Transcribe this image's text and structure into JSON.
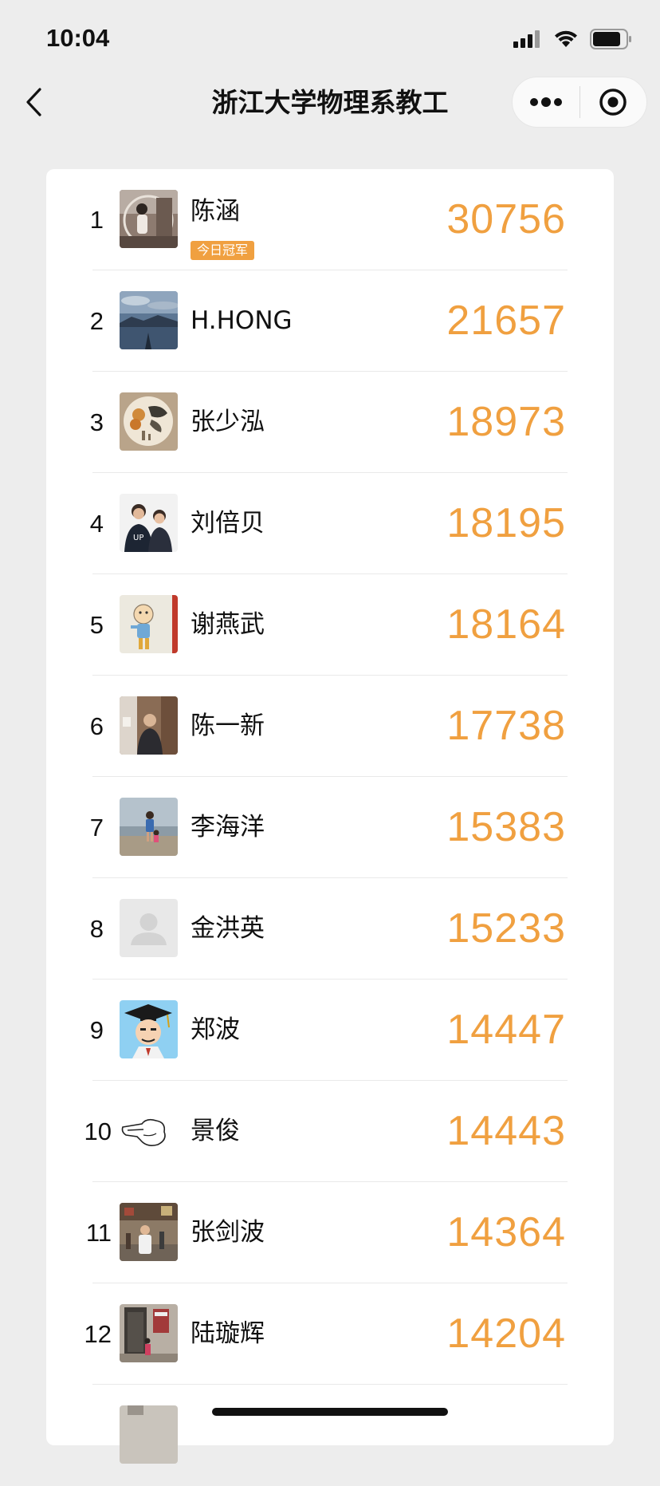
{
  "status": {
    "time": "10:04"
  },
  "nav": {
    "title": "浙江大学物理系教工"
  },
  "ranking": [
    {
      "rank": "1",
      "name": "陈涵",
      "badge": "今日冠军",
      "steps": "30756",
      "avatar": "portrait-photo"
    },
    {
      "rank": "2",
      "name": "H.HONG",
      "steps": "21657",
      "avatar": "landscape-photo"
    },
    {
      "rank": "3",
      "name": "张少泓",
      "steps": "18973",
      "avatar": "painting"
    },
    {
      "rank": "4",
      "name": "刘倍贝",
      "steps": "18195",
      "avatar": "couple-photo"
    },
    {
      "rank": "5",
      "name": "谢燕武",
      "steps": "18164",
      "avatar": "drawing"
    },
    {
      "rank": "6",
      "name": "陈一新",
      "steps": "17738",
      "avatar": "indoor-photo"
    },
    {
      "rank": "7",
      "name": "李海洋",
      "steps": "15383",
      "avatar": "beach-photo"
    },
    {
      "rank": "8",
      "name": "金洪英",
      "steps": "15233",
      "avatar": "default-avatar"
    },
    {
      "rank": "9",
      "name": "郑波",
      "steps": "14447",
      "avatar": "cartoon-graduate"
    },
    {
      "rank": "10",
      "name": "景俊",
      "steps": "14443",
      "avatar": "sketch-hand"
    },
    {
      "rank": "11",
      "name": "张剑波",
      "steps": "14364",
      "avatar": "street-photo"
    },
    {
      "rank": "12",
      "name": "陆璇辉",
      "steps": "14204",
      "avatar": "building-photo"
    }
  ],
  "colors": {
    "accent": "#f0a040",
    "background": "#ededed",
    "card": "#ffffff"
  }
}
